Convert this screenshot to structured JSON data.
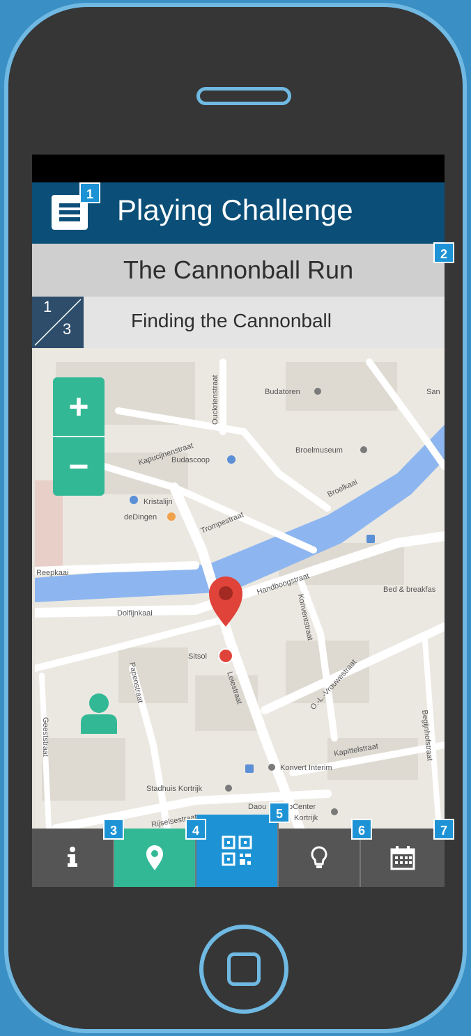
{
  "app_title": "Playing Challenge",
  "challenge_name": "The Cannonball Run",
  "step": {
    "current": "1",
    "total": "3",
    "title": "Finding the Cannonball"
  },
  "zoom": {
    "in_label": "+",
    "out_label": "−"
  },
  "map_labels": {
    "street_top": "Ouckrienstraat",
    "budatoren": "Budatoren",
    "sans": "San",
    "kapucijnenstraat": "Kapucijnenstraat",
    "budascoop": "Budascoop",
    "broelmuseum": "Broelmuseum",
    "broelkaai": "Broelkaai",
    "kristalijn": "Kristalijn",
    "dedingen": "deDingen",
    "trompestraat": "Trompestraat",
    "reepkaai": "Reepkaai",
    "handboogstraat": "Handboogstraat",
    "bed_breakfast": "Bed & breakfas",
    "dolfijnkaai": "Dolfijnkaai",
    "konventstraat": "Konventstraat",
    "ol_vrouwestraat": "O.-L.-Vrouwestraat",
    "sitsol": "Sitsol",
    "papenstraat": "Papenstraat",
    "leiestraat": "Leiestraat",
    "geeststraat": "Geeststraat",
    "kapittelstraat": "Kapittelstraat",
    "begijnhofstraat": "Begijnhofstraat",
    "konvert": "Konvert Interim",
    "stadhuis": "Stadhuis Kortrijk",
    "rijselsestraat": "Rijselsestraat",
    "daou": "Daou",
    "bcenter": "bCenter",
    "kortrijk": "Kortrijk"
  },
  "tabs": [
    {
      "name": "info",
      "icon": "info-icon"
    },
    {
      "name": "location",
      "icon": "location-pin-icon"
    },
    {
      "name": "qr",
      "icon": "qr-code-icon"
    },
    {
      "name": "hint",
      "icon": "lightbulb-icon"
    },
    {
      "name": "calendar",
      "icon": "calendar-icon"
    }
  ],
  "badges": [
    "1",
    "2",
    "3",
    "4",
    "5",
    "6",
    "7"
  ],
  "colors": {
    "appbar": "#0b4f78",
    "accent_green": "#33b896",
    "accent_blue": "#1d93d6",
    "tab_gray": "#555555",
    "phone_body": "#363636",
    "phone_outline": "#6fb9e3",
    "pin_red": "#e0433a",
    "river": "#8db6f0"
  }
}
